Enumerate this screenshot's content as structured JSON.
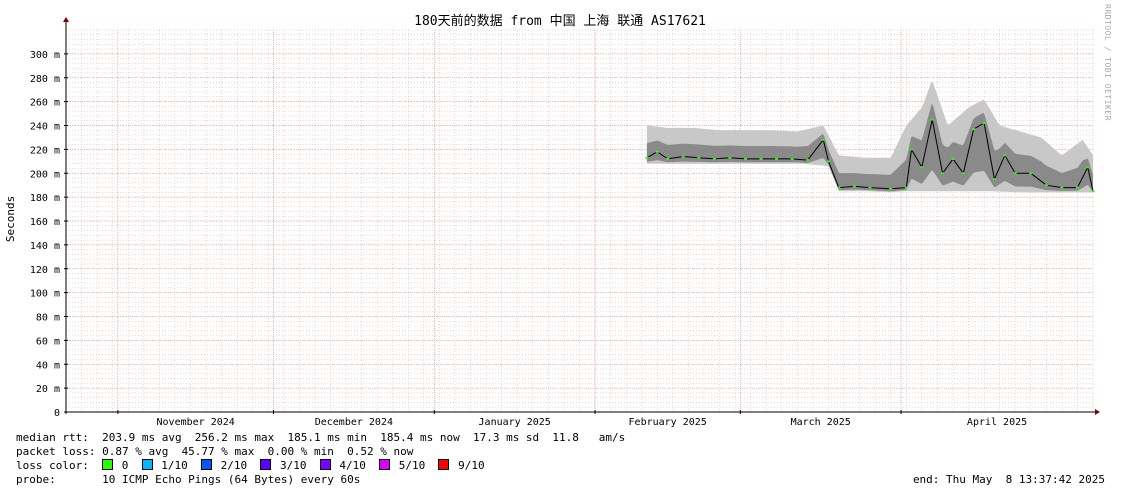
{
  "chart_data": {
    "type": "area",
    "title": "180天前的数据 from 中国 上海 联通 AS17621",
    "ylabel": "Seconds",
    "xlabel": "",
    "ylim": [
      0,
      320
    ],
    "yticks": [
      "0",
      "20 m",
      "40 m",
      "60 m",
      "80 m",
      "100 m",
      "120 m",
      "140 m",
      "160 m",
      "180 m",
      "200 m",
      "220 m",
      "240 m",
      "260 m",
      "280 m",
      "300 m"
    ],
    "ytick_values": [
      0,
      20,
      40,
      60,
      80,
      100,
      120,
      140,
      160,
      180,
      200,
      220,
      240,
      260,
      280,
      300
    ],
    "xlim": [
      "2024-10-22",
      "2025-05-08"
    ],
    "xticks": [
      {
        "label": "November 2024",
        "date": "2024-11-01"
      },
      {
        "label": "December 2024",
        "date": "2024-12-01"
      },
      {
        "label": "January 2025",
        "date": "2025-01-01"
      },
      {
        "label": "February 2025",
        "date": "2025-02-01"
      },
      {
        "label": "March 2025",
        "date": "2025-03-01"
      },
      {
        "label": "April 2025",
        "date": "2025-04-01"
      }
    ],
    "grid": true,
    "series": [
      {
        "name": "median rtt",
        "x": [
          "2025-02-11",
          "2025-02-13",
          "2025-02-15",
          "2025-02-18",
          "2025-02-21",
          "2025-02-24",
          "2025-02-27",
          "2025-03-02",
          "2025-03-05",
          "2025-03-08",
          "2025-03-11",
          "2025-03-14",
          "2025-03-17",
          "2025-03-18",
          "2025-03-20",
          "2025-03-23",
          "2025-03-26",
          "2025-03-30",
          "2025-04-02",
          "2025-04-03",
          "2025-04-05",
          "2025-04-07",
          "2025-04-09",
          "2025-04-11",
          "2025-04-13",
          "2025-04-15",
          "2025-04-17",
          "2025-04-19",
          "2025-04-21",
          "2025-04-23",
          "2025-04-26",
          "2025-04-29",
          "2025-05-02",
          "2025-05-05",
          "2025-05-07",
          "2025-05-08"
        ],
        "y": [
          213,
          218,
          212,
          214,
          213,
          212,
          213,
          212,
          212,
          212,
          212,
          211,
          228,
          210,
          188,
          189,
          188,
          187,
          188,
          220,
          205,
          245,
          200,
          212,
          200,
          237,
          242,
          195,
          215,
          200,
          200,
          190,
          188,
          188,
          205,
          185
        ]
      },
      {
        "name": "rtt max band",
        "x": [
          "2025-02-11",
          "2025-02-15",
          "2025-02-20",
          "2025-02-25",
          "2025-03-02",
          "2025-03-07",
          "2025-03-12",
          "2025-03-17",
          "2025-03-20",
          "2025-03-25",
          "2025-03-30",
          "2025-04-02",
          "2025-04-05",
          "2025-04-07",
          "2025-04-10",
          "2025-04-14",
          "2025-04-17",
          "2025-04-20",
          "2025-04-24",
          "2025-04-28",
          "2025-05-02",
          "2025-05-06",
          "2025-05-08"
        ],
        "y": [
          240,
          238,
          238,
          236,
          236,
          236,
          235,
          240,
          215,
          213,
          213,
          240,
          255,
          278,
          240,
          255,
          262,
          240,
          235,
          230,
          215,
          228,
          215
        ]
      },
      {
        "name": "rtt min band",
        "x": [
          "2025-02-11",
          "2025-02-17",
          "2025-02-23",
          "2025-03-01",
          "2025-03-07",
          "2025-03-13",
          "2025-03-18",
          "2025-03-20",
          "2025-03-25",
          "2025-03-30",
          "2025-04-02",
          "2025-04-06",
          "2025-04-12",
          "2025-04-18",
          "2025-04-24",
          "2025-04-30",
          "2025-05-05",
          "2025-05-08"
        ],
        "y": [
          208,
          208,
          208,
          208,
          208,
          208,
          206,
          185,
          185,
          184,
          185,
          185,
          185,
          185,
          184,
          184,
          184,
          184
        ]
      }
    ]
  },
  "stats": {
    "median_rtt": "median rtt:  203.9 ms avg  256.2 ms max  185.1 ms min  185.4 ms now  17.3 ms sd  11.8   am/s",
    "packet_loss": "packet loss: 0.87 % avg  45.77 % max  0.00 % min  0.52 % now",
    "loss_color_label": "loss color:",
    "loss_colors": [
      {
        "label": "0",
        "color": "#26ff00"
      },
      {
        "label": "1/10",
        "color": "#00b8ff"
      },
      {
        "label": "2/10",
        "color": "#0059ff"
      },
      {
        "label": "3/10",
        "color": "#5e00ff"
      },
      {
        "label": "4/10",
        "color": "#7e00ff"
      },
      {
        "label": "5/10",
        "color": "#dd00ff"
      },
      {
        "label": "9/10",
        "color": "#ff0000"
      }
    ],
    "probe": "probe:       10 ICMP Echo Pings (64 Bytes) every 60s",
    "end": "end: Thu May  8 13:37:42 2025"
  },
  "watermark": "RRDTOOL / TOBI OETIKER",
  "colors": {
    "grid_minor": "#eeaaaa",
    "grid_major": "#dd8888",
    "axis": "#000000",
    "arrow": "#800000",
    "smoke_light": "#c8c8c8",
    "smoke_dark": "#8a8a8a"
  }
}
